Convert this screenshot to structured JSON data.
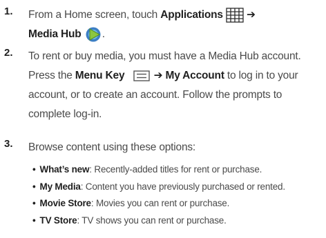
{
  "steps": [
    {
      "number": "1.",
      "line1": {
        "before": "From a Home screen, touch ",
        "bold": "Applications",
        "arrow": " ➔"
      },
      "line2": {
        "bold": "Media Hub",
        "after": "."
      }
    },
    {
      "number": "2.",
      "line1": "To rent or buy media, you must have a Media Hub account.",
      "line2": {
        "before": "Press the ",
        "bold_key": "Menu Key",
        "arrow": " ➔ ",
        "bold_account": "My Account",
        "after": " to log in to your"
      },
      "line3": "account, or to create an account. Follow the prompts to",
      "line4": "complete log-in."
    },
    {
      "number": "3.",
      "intro": "Browse content using these options:",
      "bullets": [
        {
          "term": "What’s new",
          "desc": ": Recently-added titles for rent or purchase."
        },
        {
          "term": "My Media",
          "desc": ": Content you have previously purchased or rented."
        },
        {
          "term": "Movie Store",
          "desc": ": Movies you can rent or purchase."
        },
        {
          "term": "TV Store",
          "desc": ": TV shows you can rent or purchase."
        }
      ]
    }
  ],
  "bullet_glyph": "•",
  "icons": {
    "applications": "applications-grid-icon",
    "media_hub": "media-hub-icon",
    "menu_key": "menu-key-icon"
  }
}
